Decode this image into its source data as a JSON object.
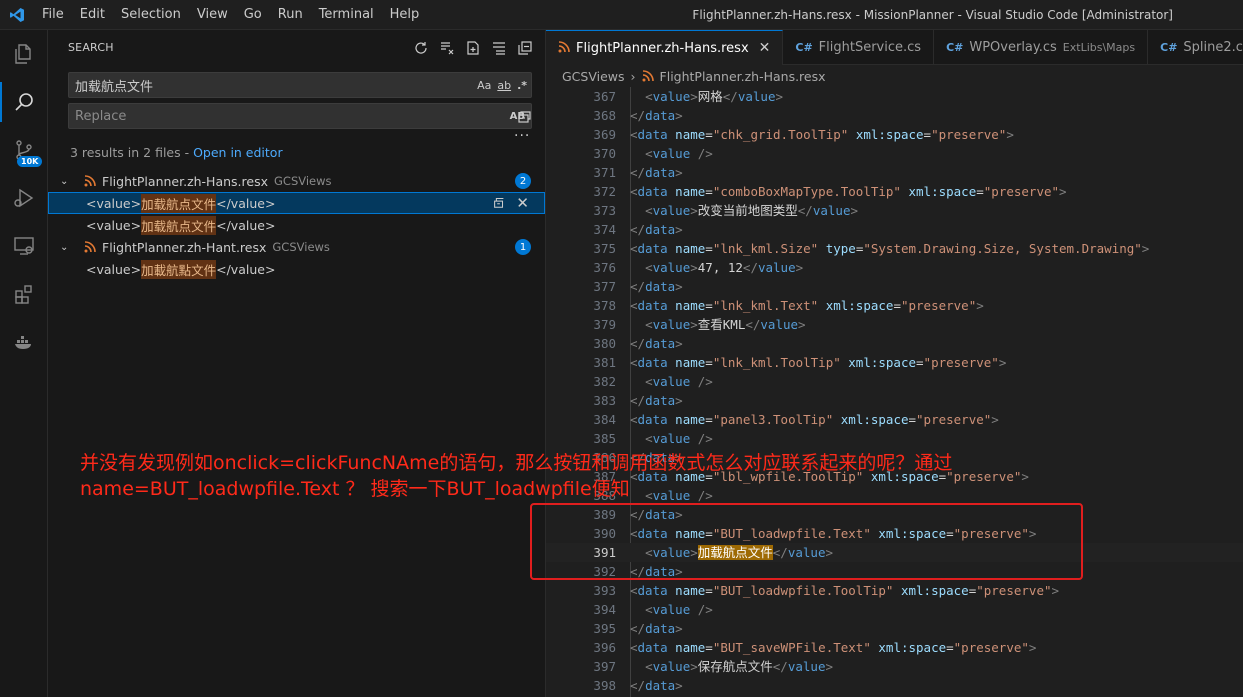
{
  "titlebar": {
    "menu": [
      "File",
      "Edit",
      "Selection",
      "View",
      "Go",
      "Run",
      "Terminal",
      "Help"
    ],
    "window_title": "FlightPlanner.zh-Hans.resx - MissionPlanner - Visual Studio Code [Administrator]"
  },
  "activity": {
    "items": [
      "explorer-icon",
      "search-icon",
      "source-control-icon",
      "run-debug-icon",
      "remote-explorer-icon",
      "extensions-icon",
      "docker-icon"
    ],
    "source_control_badge": "10K"
  },
  "search": {
    "header": "SEARCH",
    "query": "加载航点文件",
    "opt_case": "Aa",
    "opt_word": "ab",
    "opt_regex": ".*",
    "replace_placeholder": "Replace",
    "replace_opt": "AB",
    "results_text": "3 results in 2 files - ",
    "open_in_editor": "Open in editor",
    "files": [
      {
        "name": "FlightPlanner.zh-Hans.resx",
        "dir": "GCSViews",
        "count": "2",
        "matches": [
          {
            "pre": "<value>",
            "hit": "加载航点文件",
            "post": "</value>"
          },
          {
            "pre": "<value>",
            "hit": "加载航点文件",
            "post": "</value>"
          }
        ]
      },
      {
        "name": "FlightPlanner.zh-Hant.resx",
        "dir": "GCSViews",
        "count": "1",
        "matches": [
          {
            "pre": "<value>",
            "hit": "加載航點文件",
            "post": "</value>"
          }
        ]
      }
    ]
  },
  "editor": {
    "tabs": [
      {
        "label": "FlightPlanner.zh-Hans.resx",
        "dir": "",
        "icon": "rss",
        "active": true
      },
      {
        "label": "FlightService.cs",
        "dir": "",
        "icon": "csharp",
        "active": false
      },
      {
        "label": "WPOverlay.cs",
        "dir": "ExtLibs\\Maps",
        "icon": "csharp",
        "active": false
      },
      {
        "label": "Spline2.cs",
        "dir": "",
        "icon": "csharp",
        "active": false
      }
    ],
    "breadcrumb": [
      "GCSViews",
      "FlightPlanner.zh-Hans.resx"
    ],
    "current_line": 391,
    "lines": [
      {
        "n": 367,
        "indent": 2,
        "kind": "value",
        "text": "网格"
      },
      {
        "n": 368,
        "indent": 1,
        "kind": "close"
      },
      {
        "n": 369,
        "indent": 1,
        "kind": "data",
        "name": "chk_grid.ToolTip",
        "extra": "xml:space",
        "extraval": "preserve"
      },
      {
        "n": 370,
        "indent": 2,
        "kind": "empty"
      },
      {
        "n": 371,
        "indent": 1,
        "kind": "close"
      },
      {
        "n": 372,
        "indent": 1,
        "kind": "data",
        "name": "comboBoxMapType.ToolTip",
        "extra": "xml:space",
        "extraval": "preserve"
      },
      {
        "n": 373,
        "indent": 2,
        "kind": "value",
        "text": "改变当前地图类型"
      },
      {
        "n": 374,
        "indent": 1,
        "kind": "close"
      },
      {
        "n": 375,
        "indent": 1,
        "kind": "data",
        "name": "lnk_kml.Size",
        "extra": "type",
        "extraval": "System.Drawing.Size, System.Drawing"
      },
      {
        "n": 376,
        "indent": 2,
        "kind": "value",
        "text": "47, 12"
      },
      {
        "n": 377,
        "indent": 1,
        "kind": "close"
      },
      {
        "n": 378,
        "indent": 1,
        "kind": "data",
        "name": "lnk_kml.Text",
        "extra": "xml:space",
        "extraval": "preserve"
      },
      {
        "n": 379,
        "indent": 2,
        "kind": "value",
        "text": "查看KML"
      },
      {
        "n": 380,
        "indent": 1,
        "kind": "close"
      },
      {
        "n": 381,
        "indent": 1,
        "kind": "data",
        "name": "lnk_kml.ToolTip",
        "extra": "xml:space",
        "extraval": "preserve"
      },
      {
        "n": 382,
        "indent": 2,
        "kind": "empty"
      },
      {
        "n": 383,
        "indent": 1,
        "kind": "close"
      },
      {
        "n": 384,
        "indent": 1,
        "kind": "data",
        "name": "panel3.ToolTip",
        "extra": "xml:space",
        "extraval": "preserve"
      },
      {
        "n": 385,
        "indent": 2,
        "kind": "empty"
      },
      {
        "n": 386,
        "indent": 1,
        "kind": "close"
      },
      {
        "n": 387,
        "indent": 1,
        "kind": "data",
        "name": "lbl_wpfile.ToolTip",
        "extra": "xml:space",
        "extraval": "preserve"
      },
      {
        "n": 388,
        "indent": 2,
        "kind": "empty"
      },
      {
        "n": 389,
        "indent": 1,
        "kind": "close"
      },
      {
        "n": 390,
        "indent": 1,
        "kind": "data",
        "name": "BUT_loadwpfile.Text",
        "extra": "xml:space",
        "extraval": "preserve"
      },
      {
        "n": 391,
        "indent": 2,
        "kind": "value",
        "text": "加载航点文件",
        "highlight": true
      },
      {
        "n": 392,
        "indent": 1,
        "kind": "close"
      },
      {
        "n": 393,
        "indent": 1,
        "kind": "data",
        "name": "BUT_loadwpfile.ToolTip",
        "extra": "xml:space",
        "extraval": "preserve"
      },
      {
        "n": 394,
        "indent": 2,
        "kind": "empty"
      },
      {
        "n": 395,
        "indent": 1,
        "kind": "close"
      },
      {
        "n": 396,
        "indent": 1,
        "kind": "data",
        "name": "BUT_saveWPFile.Text",
        "extra": "xml:space",
        "extraval": "preserve"
      },
      {
        "n": 397,
        "indent": 2,
        "kind": "value",
        "text": "保存航点文件"
      },
      {
        "n": 398,
        "indent": 1,
        "kind": "close"
      }
    ]
  },
  "annotation": {
    "line1": "并没有发现例如onclick=clickFuncNAme的语句，那么按钮和调用函数式怎么对应联系起来的呢？通过",
    "line2": "name=BUT_loadwpfile.Text ？ 搜索一下BUT_loadwpfile便知",
    "color": "#ff2a1a"
  },
  "colors": {
    "accent": "#0078d4",
    "match_highlight": "#9e6a03",
    "annotation_red": "#e01e1e"
  }
}
